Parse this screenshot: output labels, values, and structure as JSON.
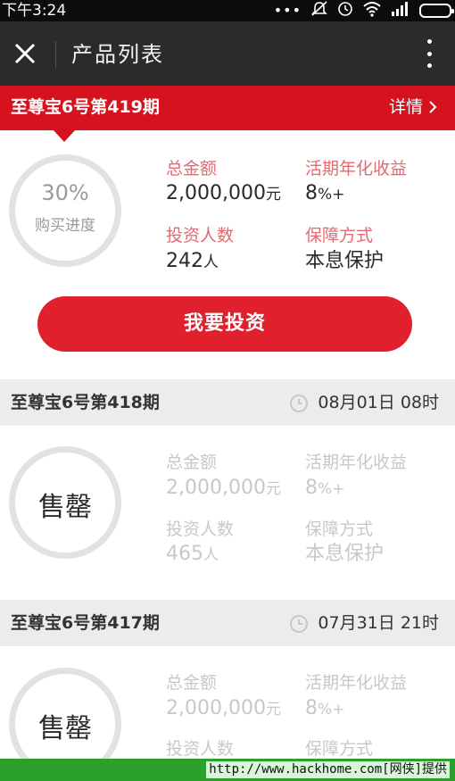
{
  "status_bar": {
    "time": "下午3:24",
    "icons": [
      "more-dots-icon",
      "mute-icon",
      "alarm-icon",
      "wifi-icon",
      "signal-icon",
      "battery-icon"
    ]
  },
  "app_bar": {
    "title": "产品列表",
    "close_icon": "close-icon",
    "more_icon": "more-vertical-icon"
  },
  "active_product": {
    "name": "至尊宝6号第419期",
    "detail_label": "详情",
    "progress_percent": "30%",
    "progress_label": "购买进度",
    "total_amount_label": "总金额",
    "total_amount_value": "2,000,000",
    "total_amount_unit": "元",
    "yield_label": "活期年化收益",
    "yield_value": "8",
    "yield_unit": "%+",
    "investors_label": "投资人数",
    "investors_value": "242",
    "investors_unit": "人",
    "guarantee_label": "保障方式",
    "guarantee_value": "本息保护",
    "invest_button": "我要投资"
  },
  "past_products": [
    {
      "name": "至尊宝6号第418期",
      "time": "08月01日 08时",
      "status": "售罄",
      "total_amount_label": "总金额",
      "total_amount_value": "2,000,000",
      "total_amount_unit": "元",
      "yield_label": "活期年化收益",
      "yield_value": "8",
      "yield_unit": "%+",
      "investors_label": "投资人数",
      "investors_value": "465",
      "investors_unit": "人",
      "guarantee_label": "保障方式",
      "guarantee_value": "本息保护"
    },
    {
      "name": "至尊宝6号第417期",
      "time": "07月31日 21时",
      "status": "售罄",
      "total_amount_label": "总金额",
      "total_amount_value": "2,000,000",
      "total_amount_unit": "元",
      "yield_label": "活期年化收益",
      "yield_value": "8",
      "yield_unit": "%+",
      "investors_label": "投资人数",
      "guarantee_label": "保障方式"
    }
  ],
  "watermark": "http://www.hackhome.com[网侠]提供",
  "colors": {
    "brand_red": "#d7121f",
    "button_red": "#e0202c",
    "label_red": "#e06b72",
    "app_bar": "#2b2b2b",
    "section_bg": "#ececec"
  }
}
